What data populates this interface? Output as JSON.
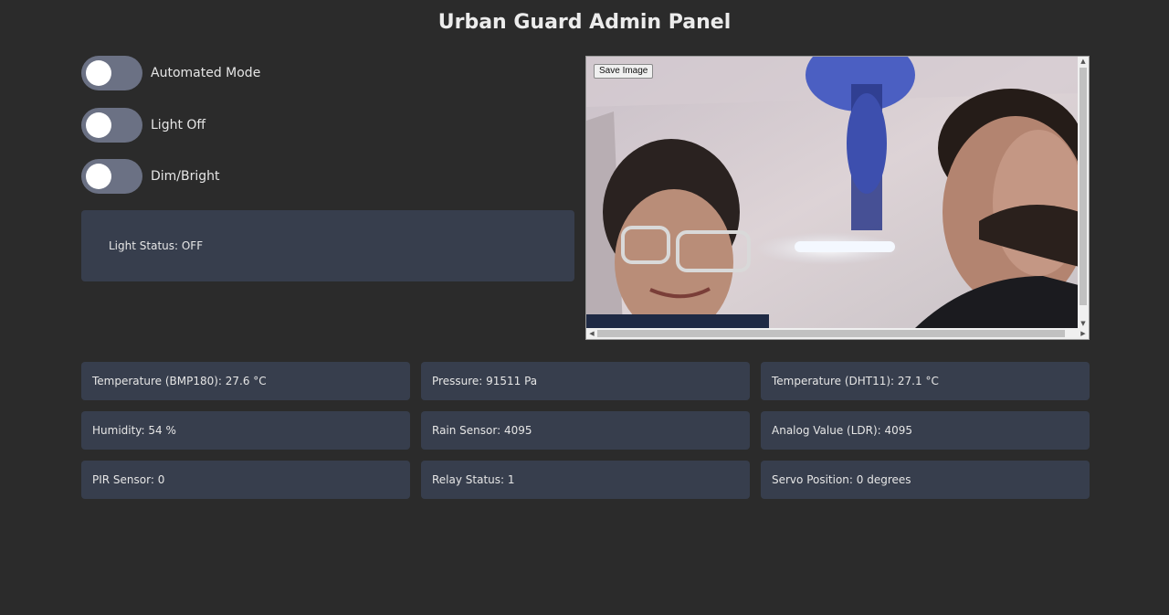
{
  "header": {
    "title": "Urban Guard Admin Panel"
  },
  "toggles": [
    {
      "label": "Automated Mode",
      "on": false
    },
    {
      "label": "Light Off",
      "on": false
    },
    {
      "label": "Dim/Bright",
      "on": false
    }
  ],
  "light_status": {
    "text": "Light Status: OFF"
  },
  "camera": {
    "save_label": "Save Image"
  },
  "sensors": [
    {
      "label": "Temperature (BMP180): 27.6 °C"
    },
    {
      "label": "Pressure: 91511 Pa"
    },
    {
      "label": "Temperature (DHT11): 27.1 °C"
    },
    {
      "label": "Humidity: 54 %"
    },
    {
      "label": "Rain Sensor: 4095"
    },
    {
      "label": "Analog Value (LDR): 4095"
    },
    {
      "label": "PIR Sensor: 0"
    },
    {
      "label": "Relay Status: 1"
    },
    {
      "label": "Servo Position: 0 degrees"
    }
  ],
  "colors": {
    "background": "#2b2b2b",
    "card": "#373e4d",
    "switch_off": "#6b7184"
  }
}
